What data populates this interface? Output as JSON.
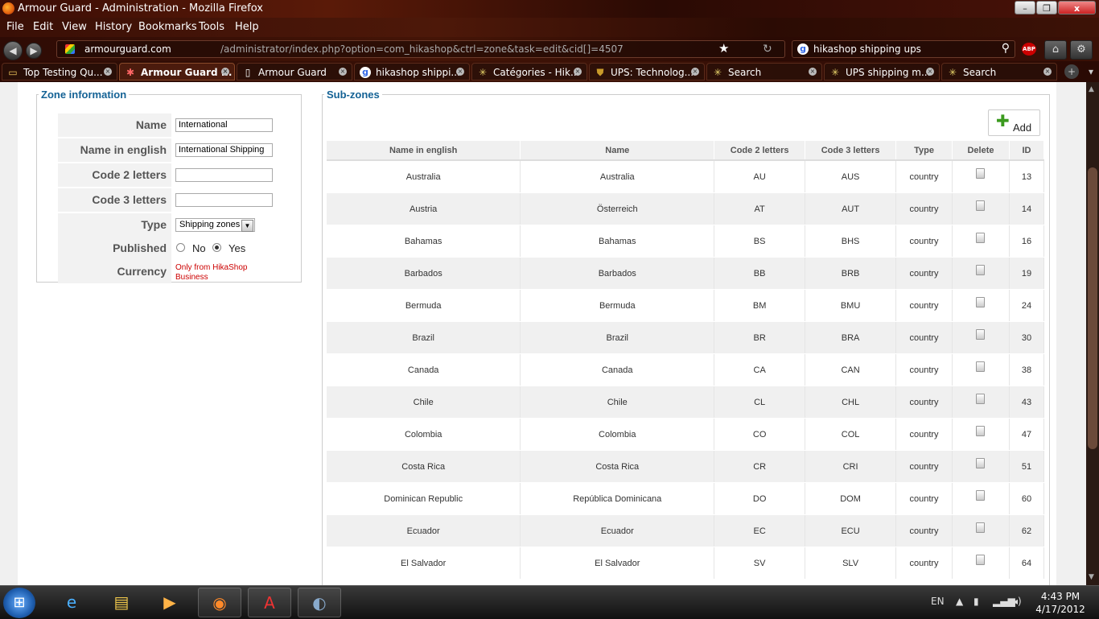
{
  "window": {
    "title": "Armour Guard - Administration - Mozilla Firefox",
    "minimize": "–",
    "maximize": "❐",
    "close": "x"
  },
  "menu": [
    "File",
    "Edit",
    "View",
    "History",
    "Bookmarks",
    "Tools",
    "Help"
  ],
  "navbar": {
    "url_host": "armourguard.com",
    "url_path": "/administrator/index.php?option=com_hikashop&ctrl=zone&task=edit&cid[]=4507",
    "search_value": "hikashop shipping ups",
    "abp_label": "ABP"
  },
  "tabs": [
    {
      "label": "Top Testing Qu...",
      "icon": "folder-icon"
    },
    {
      "label": "Armour Guard ...",
      "icon": "joomla-icon",
      "active": true
    },
    {
      "label": "Armour Guard",
      "icon": "page-icon"
    },
    {
      "label": "hikashop shippi...",
      "icon": "google-icon"
    },
    {
      "label": "Catégories - Hik...",
      "icon": "star-icon"
    },
    {
      "label": "UPS: Technolog...",
      "icon": "ups-icon"
    },
    {
      "label": "Search",
      "icon": "star-icon"
    },
    {
      "label": "UPS shipping m...",
      "icon": "star-icon"
    },
    {
      "label": "Search",
      "icon": "star-icon"
    }
  ],
  "zone_info": {
    "legend": "Zone information",
    "labels": {
      "name": "Name",
      "name_en": "Name in english",
      "code2": "Code 2 letters",
      "code3": "Code 3 letters",
      "type": "Type",
      "published": "Published",
      "currency": "Currency"
    },
    "values": {
      "name": "International",
      "name_en": "International Shipping",
      "code2": "",
      "code3": "",
      "type": "Shipping zones"
    },
    "published_no": "No",
    "published_yes": "Yes",
    "published_value": "Yes",
    "currency_note": "Only from HikaShop Business"
  },
  "subzones": {
    "legend": "Sub-zones",
    "add_label": "Add",
    "columns": [
      "Name in english",
      "Name",
      "Code 2 letters",
      "Code 3 letters",
      "Type",
      "Delete",
      "ID"
    ],
    "rows": [
      {
        "name_en": "Australia",
        "name": "Australia",
        "code2": "AU",
        "code3": "AUS",
        "type": "country",
        "id": "13"
      },
      {
        "name_en": "Austria",
        "name": "Österreich",
        "code2": "AT",
        "code3": "AUT",
        "type": "country",
        "id": "14"
      },
      {
        "name_en": "Bahamas",
        "name": "Bahamas",
        "code2": "BS",
        "code3": "BHS",
        "type": "country",
        "id": "16"
      },
      {
        "name_en": "Barbados",
        "name": "Barbados",
        "code2": "BB",
        "code3": "BRB",
        "type": "country",
        "id": "19"
      },
      {
        "name_en": "Bermuda",
        "name": "Bermuda",
        "code2": "BM",
        "code3": "BMU",
        "type": "country",
        "id": "24"
      },
      {
        "name_en": "Brazil",
        "name": "Brazil",
        "code2": "BR",
        "code3": "BRA",
        "type": "country",
        "id": "30"
      },
      {
        "name_en": "Canada",
        "name": "Canada",
        "code2": "CA",
        "code3": "CAN",
        "type": "country",
        "id": "38"
      },
      {
        "name_en": "Chile",
        "name": "Chile",
        "code2": "CL",
        "code3": "CHL",
        "type": "country",
        "id": "43"
      },
      {
        "name_en": "Colombia",
        "name": "Colombia",
        "code2": "CO",
        "code3": "COL",
        "type": "country",
        "id": "47"
      },
      {
        "name_en": "Costa Rica",
        "name": "Costa Rica",
        "code2": "CR",
        "code3": "CRI",
        "type": "country",
        "id": "51"
      },
      {
        "name_en": "Dominican Republic",
        "name": "República Dominicana",
        "code2": "DO",
        "code3": "DOM",
        "type": "country",
        "id": "60"
      },
      {
        "name_en": "Ecuador",
        "name": "Ecuador",
        "code2": "EC",
        "code3": "ECU",
        "type": "country",
        "id": "62"
      },
      {
        "name_en": "El Salvador",
        "name": "El Salvador",
        "code2": "SV",
        "code3": "SLV",
        "type": "country",
        "id": "64"
      }
    ]
  },
  "taskbar": {
    "language": "EN",
    "time": "4:43 PM",
    "date": "4/17/2012"
  }
}
